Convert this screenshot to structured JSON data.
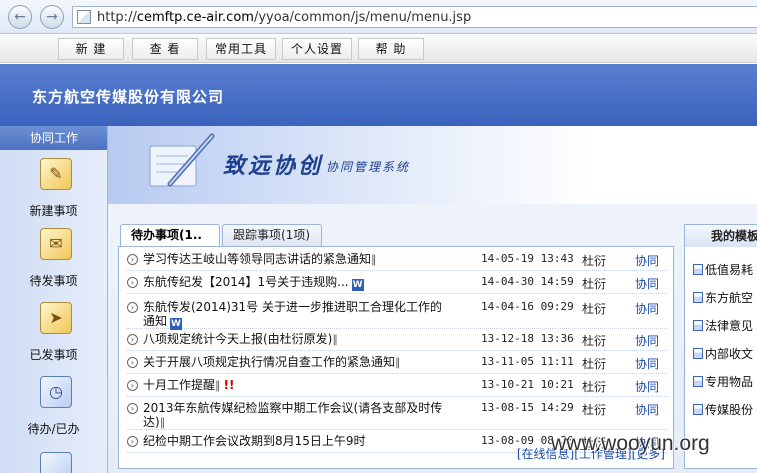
{
  "browser": {
    "url_plain": "http://",
    "url_host": "cemftp.ce-air.com",
    "url_path": "/yyoa/common/js/menu/menu.jsp"
  },
  "menubar": {
    "items": [
      "新 建",
      "查 看",
      "常用工具",
      "个人设置",
      "帮 助"
    ]
  },
  "banner": {
    "company": "东方航空传媒股份有限公司"
  },
  "sidebar": {
    "header": "协同工作",
    "items": [
      {
        "label": "新建事项",
        "icon": "new-item-icon"
      },
      {
        "label": "待发事项",
        "icon": "pending-send-icon"
      },
      {
        "label": "已发事项",
        "icon": "sent-items-icon"
      },
      {
        "label": "待办/已办",
        "icon": "todo-done-icon"
      }
    ]
  },
  "logo": {
    "title": "致远协创",
    "subtitle": "协同管理系统"
  },
  "tabs": [
    {
      "label": "待办事项(1..",
      "active": true
    },
    {
      "label": "跟踪事项(1项)",
      "active": false
    }
  ],
  "todo_rows": [
    {
      "title": "学习传达王岐山等领导同志讲话的紧急通知",
      "attach": true,
      "word": false,
      "urgent": false,
      "date": "14-05-19 13:43",
      "user": "杜衍",
      "link": "协同"
    },
    {
      "title": "东航传纪发【2014】1号关于违规购...",
      "attach": false,
      "word": true,
      "urgent": false,
      "date": "14-04-30 14:59",
      "user": "杜衍",
      "link": "协同"
    },
    {
      "title": "东航传发(2014)31号 关于进一步推进职工合理化工作的通知",
      "attach": false,
      "word": true,
      "urgent": false,
      "date": "14-04-16 09:29",
      "user": "杜衍",
      "link": "协同"
    },
    {
      "title": "八项规定统计今天上报(由杜衍原发)",
      "attach": true,
      "word": false,
      "urgent": false,
      "date": "13-12-18 13:36",
      "user": "杜衍",
      "link": "协同"
    },
    {
      "title": "关于开展八项规定执行情况自查工作的紧急通知",
      "attach": true,
      "word": false,
      "urgent": false,
      "date": "13-11-05 11:11",
      "user": "杜衍",
      "link": "协同"
    },
    {
      "title": "十月工作提醒",
      "attach": true,
      "word": false,
      "urgent": true,
      "date": "13-10-21 10:21",
      "user": "杜衍",
      "link": "协同"
    },
    {
      "title": "2013年东航传媒纪检监察中期工作会议(请各支部及时传达)",
      "attach": true,
      "word": false,
      "urgent": false,
      "date": "13-08-15 14:29",
      "user": "杜衍",
      "link": "协同"
    },
    {
      "title": "纪检中期工作会议改期到8月15日上午9时",
      "attach": false,
      "word": false,
      "urgent": false,
      "date": "13-08-09 08:20",
      "user": "杜衍",
      "link": "协同"
    }
  ],
  "footer": {
    "online": "[在线信息]",
    "work": "[工作管理]",
    "more": "[更多]"
  },
  "right_panel": {
    "header": "我的模板",
    "items": [
      "低值易耗",
      "东方航空",
      "法律意见",
      "内部收文",
      "专用物品",
      "传媒股份"
    ]
  },
  "watermark": "www.wooyun.org",
  "colors": {
    "banner": "#3a63bd",
    "link": "#1b4aa8",
    "urgent": "#d40000"
  }
}
